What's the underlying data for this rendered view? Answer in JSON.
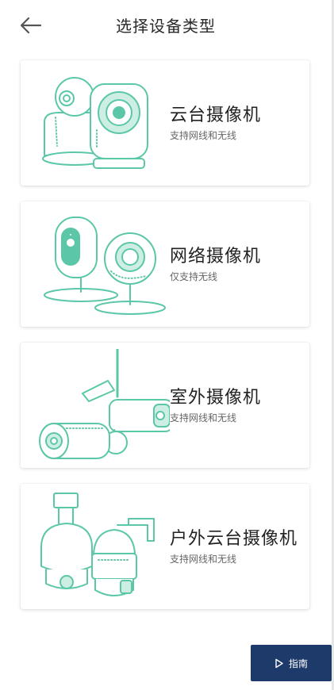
{
  "header": {
    "title": "选择设备类型"
  },
  "devices": [
    {
      "name": "云台摄像机",
      "desc": "支持网线和无线",
      "icon": "pan-tilt-camera-icon"
    },
    {
      "name": "网络摄像机",
      "desc": "仅支持无线",
      "icon": "network-camera-icon"
    },
    {
      "name": "室外摄像机",
      "desc": "支持网线和无线",
      "icon": "outdoor-camera-icon"
    },
    {
      "name": "户外云台摄像机",
      "desc": "支持网线和无线",
      "icon": "outdoor-ptz-camera-icon"
    }
  ],
  "guide": {
    "label": "指南",
    "icon": "play-triangle-icon"
  },
  "colors": {
    "accent": "#5cc7a8",
    "guide_bg": "#1e3a6a"
  }
}
